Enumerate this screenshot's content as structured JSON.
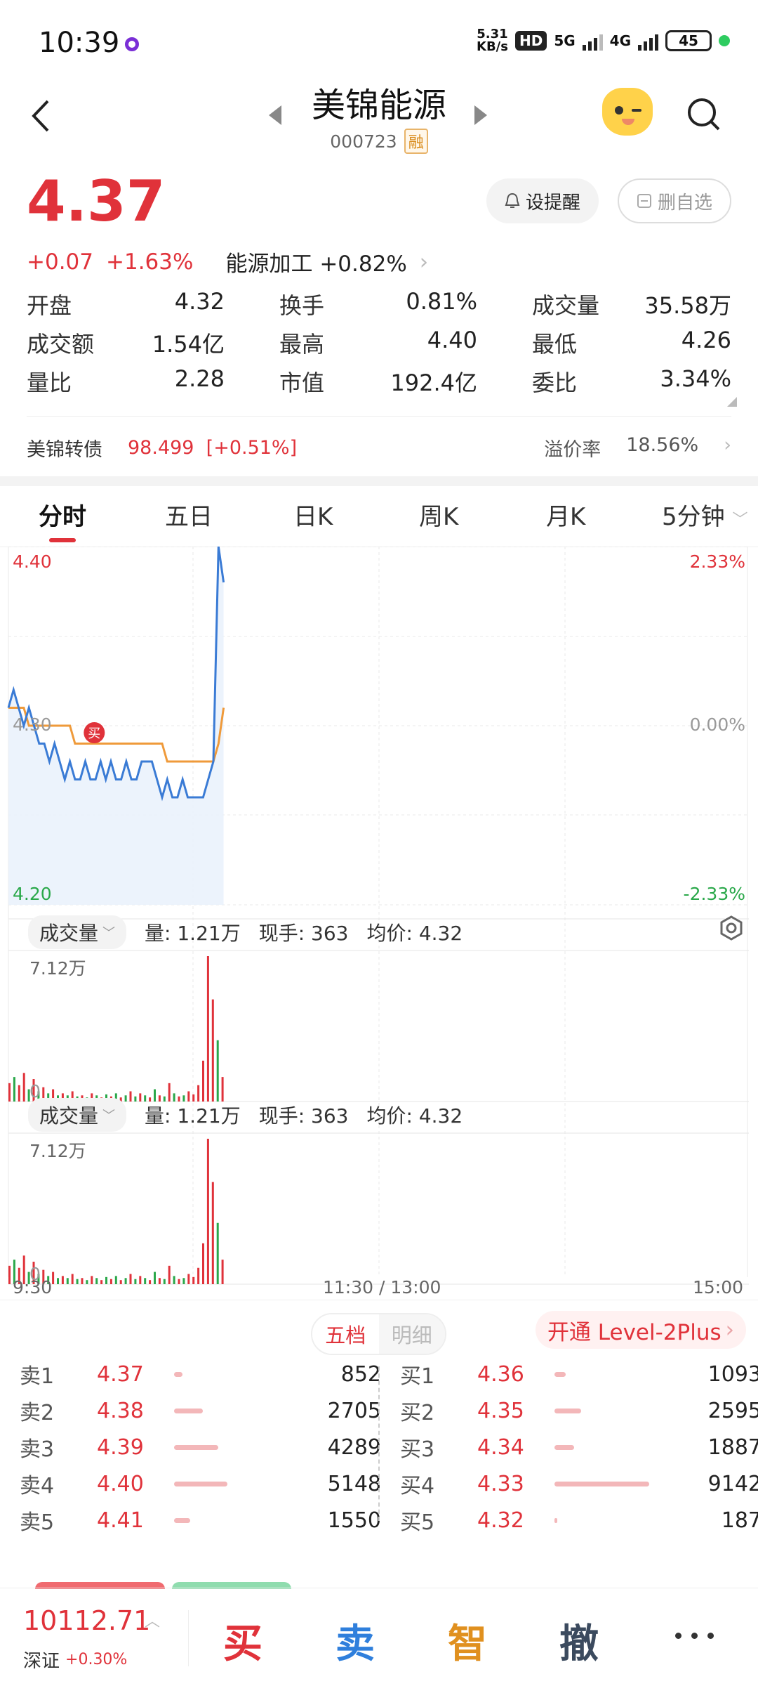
{
  "status": {
    "time": "10:39",
    "net_speed_top": "5.31",
    "net_speed_bottom": "KB/s",
    "hd": "HD",
    "net1": "5G",
    "net2": "4G",
    "battery": "45"
  },
  "header": {
    "title": "美锦能源",
    "code": "000723",
    "badge": "融"
  },
  "quote": {
    "price": "4.37",
    "change": "+0.07",
    "change_pct": "+1.63%",
    "sector": "能源加工",
    "sector_pct": "+0.82%",
    "alert_btn": "设提醒",
    "del_btn": "删自选"
  },
  "stats": [
    [
      {
        "label": "开盘",
        "value": "4.32",
        "color": "red"
      },
      {
        "label": "换手",
        "value": "0.81%",
        "color": "normal"
      },
      {
        "label": "成交量",
        "value": "35.58万",
        "color": "normal"
      }
    ],
    [
      {
        "label": "成交额",
        "value": "1.54亿",
        "color": "normal"
      },
      {
        "label": "最高",
        "value": "4.40",
        "color": "red"
      },
      {
        "label": "最低",
        "value": "4.26",
        "color": "green"
      }
    ],
    [
      {
        "label": "量比",
        "value": "2.28",
        "color": "normal"
      },
      {
        "label": "市值",
        "value": "192.4亿",
        "color": "normal"
      },
      {
        "label": "委比",
        "value": "3.34%",
        "color": "red"
      }
    ]
  ],
  "bond": {
    "label": "美锦转债",
    "value": "98.499",
    "pct": "[+0.51%]",
    "premium_label": "溢价率",
    "premium_value": "18.56%"
  },
  "tabs": [
    "分时",
    "五日",
    "日K",
    "周K",
    "月K",
    "5分钟"
  ],
  "chart": {
    "y_top": "4.40",
    "y_mid": "4.30",
    "y_bot": "4.20",
    "pct_top": "2.33%",
    "pct_mid": "0.00%",
    "pct_bot": "-2.33%",
    "buy_marker": "买",
    "vol_max": "7.12万",
    "vol_zero": "0",
    "time_start": "9:30",
    "time_mid": "11:30 / 13:00",
    "time_end": "15:00"
  },
  "chart_data": {
    "type": "line",
    "title": "",
    "ylim": [
      4.2,
      4.4
    ],
    "price_series": [
      4.31,
      4.32,
      4.31,
      4.3,
      4.31,
      4.3,
      4.29,
      4.29,
      4.28,
      4.29,
      4.28,
      4.27,
      4.28,
      4.27,
      4.27,
      4.28,
      4.27,
      4.27,
      4.28,
      4.27,
      4.28,
      4.27,
      4.27,
      4.28,
      4.27,
      4.27,
      4.28,
      4.28,
      4.28,
      4.27,
      4.26,
      4.27,
      4.26,
      4.26,
      4.27,
      4.26,
      4.26,
      4.26,
      4.26,
      4.27,
      4.28,
      4.4,
      4.38
    ],
    "avg_series": [
      4.31,
      4.31,
      4.31,
      4.31,
      4.3,
      4.3,
      4.3,
      4.3,
      4.3,
      4.3,
      4.3,
      4.3,
      4.3,
      4.29,
      4.29,
      4.29,
      4.29,
      4.29,
      4.29,
      4.29,
      4.29,
      4.29,
      4.29,
      4.29,
      4.29,
      4.29,
      4.29,
      4.29,
      4.29,
      4.29,
      4.29,
      4.28,
      4.28,
      4.28,
      4.28,
      4.28,
      4.28,
      4.28,
      4.28,
      4.28,
      4.28,
      4.29,
      4.31
    ],
    "volume_ylim": [
      0,
      71200
    ],
    "volume_series": [
      9000,
      12000,
      8000,
      14000,
      6000,
      11000,
      5000,
      7000,
      4000,
      6000,
      3000,
      4000,
      3000,
      5000,
      2500,
      3000,
      2000,
      4000,
      3000,
      2000,
      3500,
      2500,
      4000,
      2000,
      3000,
      5000,
      2500,
      4000,
      3000,
      2000,
      6000,
      3000,
      2500,
      9000,
      4000,
      2500,
      3000,
      5000,
      3500,
      8000,
      20000,
      71200,
      50000,
      30000,
      12000
    ],
    "volume_up": [
      true,
      false,
      true,
      true,
      false,
      true,
      false,
      true,
      false,
      true,
      false,
      true,
      false,
      true,
      false,
      true,
      false,
      true,
      false,
      true,
      false,
      true,
      false,
      true,
      false,
      true,
      false,
      true,
      false,
      true,
      false,
      true,
      false,
      true,
      false,
      true,
      false,
      true,
      true,
      true,
      true,
      true,
      true,
      false,
      true
    ]
  },
  "volume_header": {
    "selector": "成交量",
    "vol_label": "量: 1.21万",
    "hand_label": "现手: 363",
    "avg_label": "均价: 4.32"
  },
  "order_book": {
    "tab_a": "五档",
    "tab_b": "明细",
    "level2": "开通 Level-2Plus",
    "asks": [
      {
        "label": "卖1",
        "price": "4.37",
        "qty": "852",
        "ratio": 0.09
      },
      {
        "label": "卖2",
        "price": "4.38",
        "qty": "2705",
        "ratio": 0.3
      },
      {
        "label": "卖3",
        "price": "4.39",
        "qty": "4289",
        "ratio": 0.47
      },
      {
        "label": "卖4",
        "price": "4.40",
        "qty": "5148",
        "ratio": 0.56
      },
      {
        "label": "卖5",
        "price": "4.41",
        "qty": "1550",
        "ratio": 0.17
      }
    ],
    "bids": [
      {
        "label": "买1",
        "price": "4.36",
        "qty": "1093",
        "ratio": 0.12
      },
      {
        "label": "买2",
        "price": "4.35",
        "qty": "2595",
        "ratio": 0.28
      },
      {
        "label": "买3",
        "price": "4.34",
        "qty": "1887",
        "ratio": 0.21
      },
      {
        "label": "买4",
        "price": "4.33",
        "qty": "9142",
        "ratio": 1.0
      },
      {
        "label": "买5",
        "price": "4.32",
        "qty": "187",
        "ratio": 0.02
      }
    ]
  },
  "bottom": {
    "index_value": "10112.71",
    "index_name": "深证",
    "index_pct": "+0.30%",
    "buy": "买",
    "sell": "卖",
    "smart": "智",
    "cancel": "撤"
  }
}
